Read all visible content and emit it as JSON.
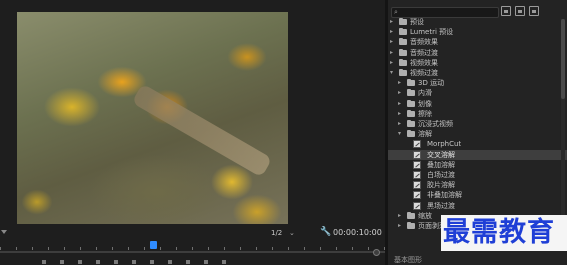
{
  "program_monitor": {
    "zoom": "1/2",
    "zoom_chevron": "⌄",
    "timecode": "00:00:10:00",
    "wrench_icon": "wrench-icon",
    "transport_icons": [
      "mark-in-icon",
      "mark-out-icon",
      "go-to-in-icon",
      "step-back-icon",
      "play-icon",
      "step-forward-icon",
      "go-to-out-icon",
      "lift-icon",
      "extract-icon",
      "export-frame-icon",
      "add-icon"
    ]
  },
  "effects_panel": {
    "search": {
      "value": "",
      "placeholder": ""
    },
    "toolbar_icons": [
      "accelerated-effects-icon",
      "32bit-effects-icon",
      "yuv-effects-icon"
    ],
    "tree": [
      {
        "label": "预设",
        "level": 0,
        "expanded": false,
        "type": "folder"
      },
      {
        "label": "Lumetri 预设",
        "level": 0,
        "expanded": false,
        "type": "folder"
      },
      {
        "label": "音频效果",
        "level": 0,
        "expanded": false,
        "type": "folder"
      },
      {
        "label": "音频过渡",
        "level": 0,
        "expanded": false,
        "type": "folder"
      },
      {
        "label": "视频效果",
        "level": 0,
        "expanded": false,
        "type": "folder"
      },
      {
        "label": "视频过渡",
        "level": 0,
        "expanded": true,
        "type": "folder"
      },
      {
        "label": "3D 运动",
        "level": 1,
        "expanded": false,
        "type": "folder"
      },
      {
        "label": "内滑",
        "level": 1,
        "expanded": false,
        "type": "folder"
      },
      {
        "label": "划像",
        "level": 1,
        "expanded": false,
        "type": "folder"
      },
      {
        "label": "擦除",
        "level": 1,
        "expanded": false,
        "type": "folder"
      },
      {
        "label": "沉浸式视频",
        "level": 1,
        "expanded": false,
        "type": "folder"
      },
      {
        "label": "溶解",
        "level": 1,
        "expanded": true,
        "type": "folder"
      },
      {
        "label": "MorphCut",
        "level": 2,
        "type": "effect"
      },
      {
        "label": "交叉溶解",
        "level": 2,
        "type": "effect",
        "selected": true
      },
      {
        "label": "叠加溶解",
        "level": 2,
        "type": "effect"
      },
      {
        "label": "白场过渡",
        "level": 2,
        "type": "effect"
      },
      {
        "label": "胶片溶解",
        "level": 2,
        "type": "effect"
      },
      {
        "label": "非叠加溶解",
        "level": 2,
        "type": "effect"
      },
      {
        "label": "黑场过渡",
        "level": 2,
        "type": "effect"
      },
      {
        "label": "缩放",
        "level": 1,
        "expanded": false,
        "type": "folder"
      },
      {
        "label": "页面剥落",
        "level": 1,
        "expanded": false,
        "type": "folder"
      }
    ],
    "bottom_label": "基本图形"
  },
  "watermark": {
    "text": "最需教育"
  }
}
